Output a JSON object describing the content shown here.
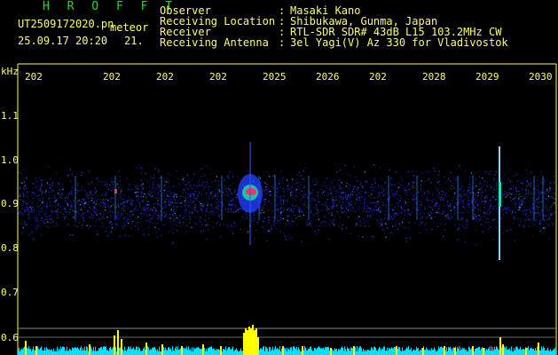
{
  "header": {
    "title": "H R O F F T",
    "filename": "UT2509172020.pn",
    "mode": "meteor",
    "datetime": "25.09.17 20:20",
    "count": "21.",
    "labels": [
      "Observer",
      "Receiving Location",
      "Receiver",
      "Receiving Antenna"
    ],
    "colons": [
      ":",
      ":",
      ":",
      ":"
    ],
    "values": [
      "Masaki Kano",
      "Shibukawa, Gunma, Japan",
      "RTL-SDR SDR# 43dB L15 103.2MHz CW",
      "3el Yagi(V) Az 330 for Vladivostok"
    ]
  },
  "axis": {
    "unit": "kHz",
    "y_ticks": [
      "1.1",
      "1.0",
      "0.9",
      "0.8",
      "0.7",
      "0.6"
    ],
    "x_ticks": [
      "202",
      "202",
      "202",
      "202",
      "2025",
      "2026",
      "202",
      "2028",
      "2029",
      "2030"
    ]
  },
  "colors": {
    "background": "#000000",
    "text": "#ffff66",
    "title": "#22dd22",
    "noise_blue": "#2040ff",
    "meteor_red": "#ff3060",
    "spectrum_cyan": "#00e0ff",
    "spectrum_yellow": "#ffff00"
  }
}
